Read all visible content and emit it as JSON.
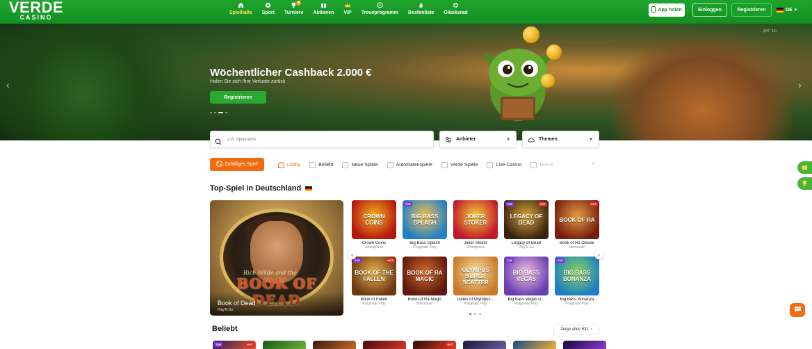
{
  "header": {
    "logo_main": "VERDE",
    "logo_sub": "CASINO",
    "nav": [
      {
        "label": "Spielhalle",
        "icon": "home-icon",
        "active": true
      },
      {
        "label": "Sport",
        "icon": "ball-icon"
      },
      {
        "label": "Turniere",
        "icon": "trophy-icon",
        "badge": "8"
      },
      {
        "label": "Aktionen",
        "icon": "gift-icon"
      },
      {
        "label": "VIP",
        "icon": "crown-icon"
      },
      {
        "label": "Treueprogramm",
        "icon": "loyalty-icon"
      },
      {
        "label": "Bestenliste",
        "icon": "flame-icon"
      },
      {
        "label": "Glücksrad",
        "icon": "wheel-icon"
      }
    ],
    "app_button": "App holen",
    "login_button": "Einloggen",
    "register_button": "Registrieren",
    "language": "DE"
  },
  "hero": {
    "title": "Wöchentlicher Cashback 2.000 €",
    "subtitle": "Holen Sie sich Ihre Verluste zurück",
    "cta": "Registrieren",
    "terms": "ДНГ, 18+",
    "slide_count": 4,
    "active_slide": 2
  },
  "search": {
    "placeholder": "Z.B. Spielname",
    "provider_label": "Anbieter",
    "themes_label": "Themen"
  },
  "categories": {
    "random_button": "Zufälliges Spiel",
    "items": [
      "Lobby",
      "Beliebt",
      "Neue Spiele",
      "Automatenspiele",
      "Verde Spiele",
      "Live-Casino",
      "Bonus"
    ],
    "active": "Lobby"
  },
  "top_section": {
    "title": "Top-Spiel in Deutschland",
    "featured": {
      "name": "Book of Dead",
      "provider": "Play'N Go",
      "art_text": "BOOK OF DEAD",
      "art_small": "Rich Wilde and the"
    },
    "games": [
      {
        "name": "Crown Coins",
        "provider": "Endorphina",
        "art": "CROWN COINS",
        "color": "#b5180f",
        "color2": "#f4b21f",
        "top": false,
        "hot": false
      },
      {
        "name": "Big Bass Splash",
        "provider": "Pragmatic Play",
        "art": "BIG BASS SPLASH",
        "color": "#1f7fc7",
        "color2": "#f2c04a",
        "top": true,
        "hot": false
      },
      {
        "name": "Joker Stoker",
        "provider": "Endorphina",
        "art": "JOKER STOKER",
        "color": "#c2182a",
        "color2": "#f2d23a",
        "top": false,
        "hot": false
      },
      {
        "name": "Legacy of Dead",
        "provider": "Play'N Go",
        "art": "LEGACY OF DEAD",
        "color": "#3a2410",
        "color2": "#d9a33a",
        "top": true,
        "hot": true
      },
      {
        "name": "Book of Ra Deluxe",
        "provider": "Novomatic",
        "art": "BOOK OF RA",
        "color": "#7a1d10",
        "color2": "#e0a040",
        "top": false,
        "hot": true
      },
      {
        "name": "Book of Fallen",
        "provider": "Pragmatic Play",
        "art": "BOOK OF THE FALLEN",
        "color": "#6e3a14",
        "color2": "#e8b24a",
        "top": true,
        "hot": true
      },
      {
        "name": "Book Of Ra Magic",
        "provider": "Novomatic",
        "art": "BOOK OF RA MAGIC",
        "color": "#5e1a10",
        "color2": "#d26a2a",
        "top": false,
        "hot": false
      },
      {
        "name": "Gates of Olympus...",
        "provider": "Pragmatic Play",
        "art": "OLYMPUS SUPER SCATTER",
        "color": "#c77a28",
        "color2": "#f7e0a8",
        "top": false,
        "hot": false
      },
      {
        "name": "Big Bass Vegas D...",
        "provider": "Pragmatic Play",
        "art": "BIG BASS VEGAS",
        "color": "#6a3fb0",
        "color2": "#f0c0e0",
        "top": true,
        "hot": false
      },
      {
        "name": "Big Bass Bonanza",
        "provider": "Pragmatic Play",
        "art": "BIG BASS BONANZA",
        "color": "#1c7fc2",
        "color2": "#8fd45a",
        "top": true,
        "hot": false
      }
    ],
    "pages": 3,
    "active_page": 1
  },
  "popular_section": {
    "title": "Beliebt",
    "show_all": "Zeige alles 531"
  },
  "colors": {
    "header_green": "#1ea52c",
    "accent_orange": "#f16b10",
    "cta_green": "#2aa832"
  }
}
